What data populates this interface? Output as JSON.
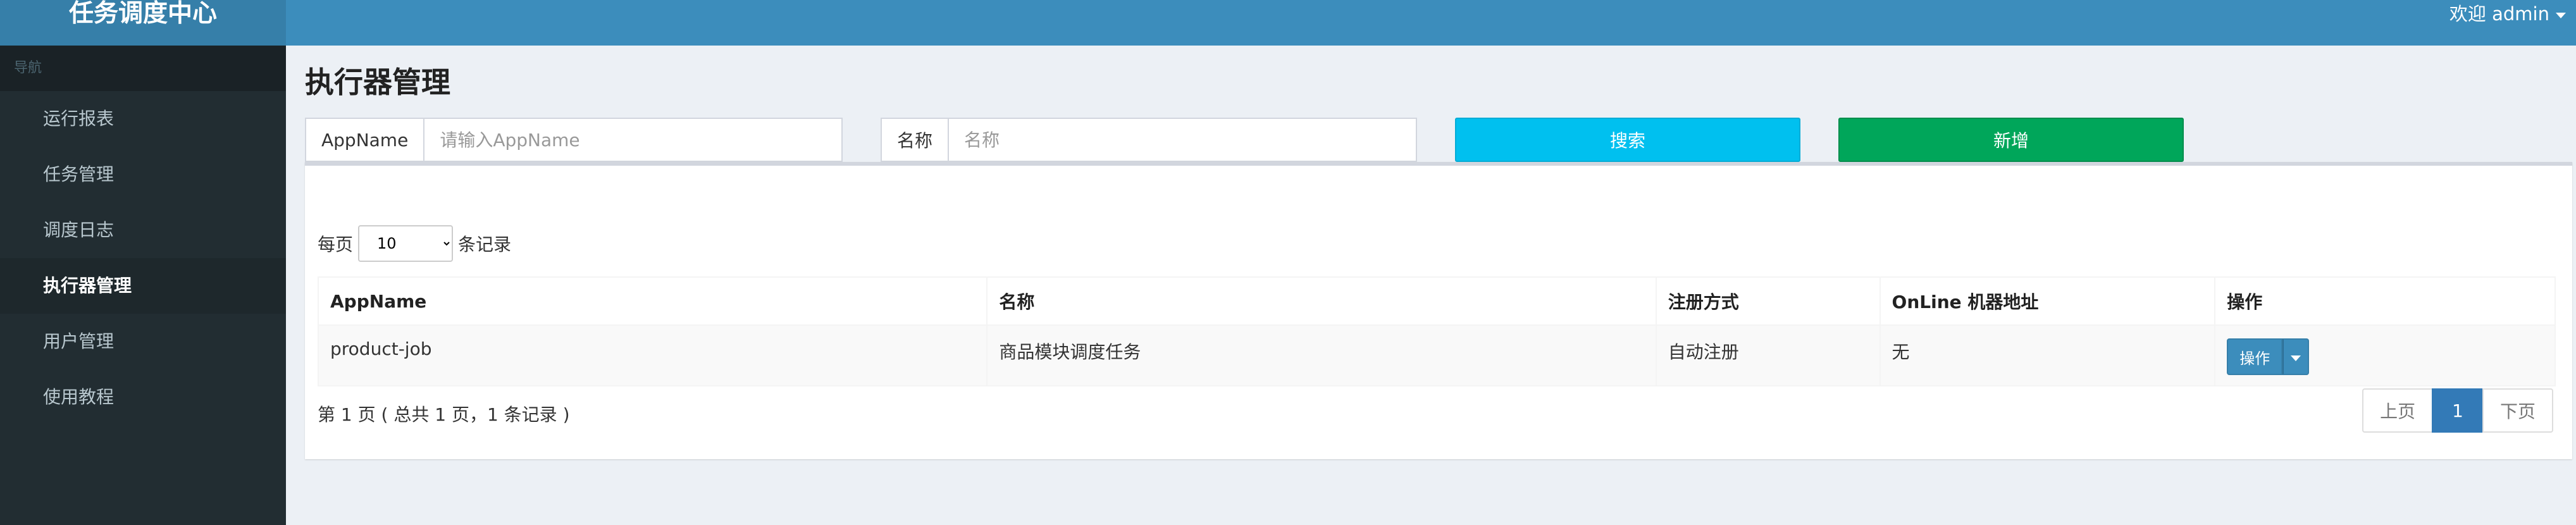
{
  "header": {
    "brand": "任务调度中心",
    "user_label": "欢迎 admin"
  },
  "sidebar": {
    "section_label": "导航",
    "items": [
      {
        "label": "运行报表"
      },
      {
        "label": "任务管理"
      },
      {
        "label": "调度日志"
      },
      {
        "label": "执行器管理",
        "active": true
      },
      {
        "label": "用户管理"
      },
      {
        "label": "使用教程"
      }
    ]
  },
  "main": {
    "title": "执行器管理",
    "filters": {
      "appname_label": "AppName",
      "appname_placeholder": "请输入AppName",
      "appname_value": "",
      "name_label": "名称",
      "name_placeholder": "名称",
      "name_value": ""
    },
    "buttons": {
      "search": "搜索",
      "add": "新增"
    },
    "length": {
      "prefix": "每页",
      "value": "10",
      "suffix": "条记录"
    },
    "table": {
      "headers": [
        "AppName",
        "名称",
        "注册方式",
        "OnLine 机器地址",
        "操作"
      ],
      "rows": [
        {
          "appname": "product-job",
          "name": "商品模块调度任务",
          "registry": "自动注册",
          "online": "无",
          "action": "操作"
        }
      ]
    },
    "info": "第 1 页 ( 总共 1 页，1 条记录 )",
    "pagination": {
      "prev": "上页",
      "current": "1",
      "next": "下页"
    }
  },
  "colors": {
    "header": "#3c8dbc",
    "brand_bg": "#367fa9",
    "sidebar": "#222d32",
    "search_button": "#00c0ef",
    "add_button": "#00a65a",
    "primary": "#337ab7"
  }
}
